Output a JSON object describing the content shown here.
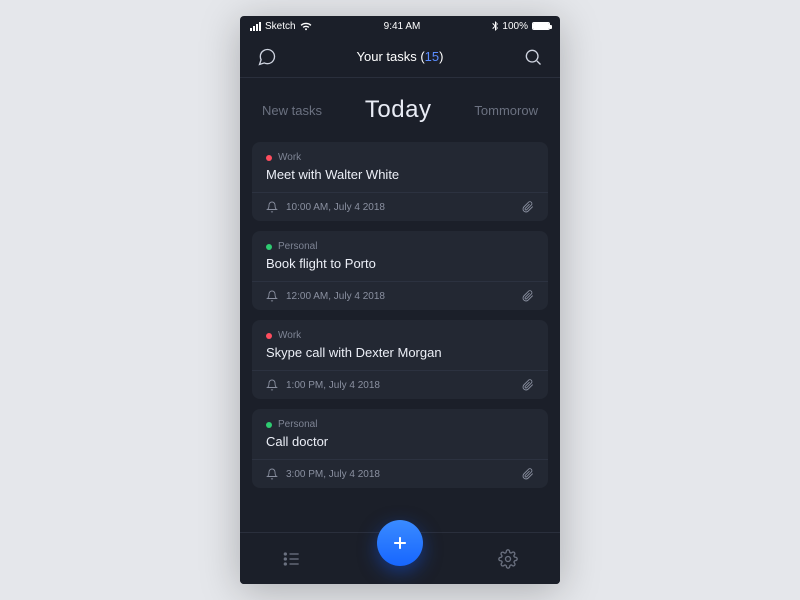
{
  "status": {
    "carrier": "Sketch",
    "time": "9:41 AM",
    "battery": "100%"
  },
  "header": {
    "title_prefix": "Your tasks (",
    "count": "15",
    "title_suffix": ")"
  },
  "tabs": {
    "left": "New tasks",
    "center": "Today",
    "right": "Tommorow"
  },
  "categories": {
    "work": {
      "label": "Work",
      "color": "#ff4d5e"
    },
    "personal": {
      "label": "Personal",
      "color": "#2ecc71"
    }
  },
  "tasks": [
    {
      "category": "work",
      "title": "Meet with Walter White",
      "time": "10:00 AM, July 4 2018",
      "attachment": true
    },
    {
      "category": "personal",
      "title": "Book flight to Porto",
      "time": "12:00 AM, July 4 2018",
      "attachment": true
    },
    {
      "category": "work",
      "title": "Skype call with Dexter Morgan",
      "time": "1:00 PM, July 4 2018",
      "attachment": true
    },
    {
      "category": "personal",
      "title": "Call doctor",
      "time": "3:00 PM, July 4 2018",
      "attachment": true
    }
  ]
}
